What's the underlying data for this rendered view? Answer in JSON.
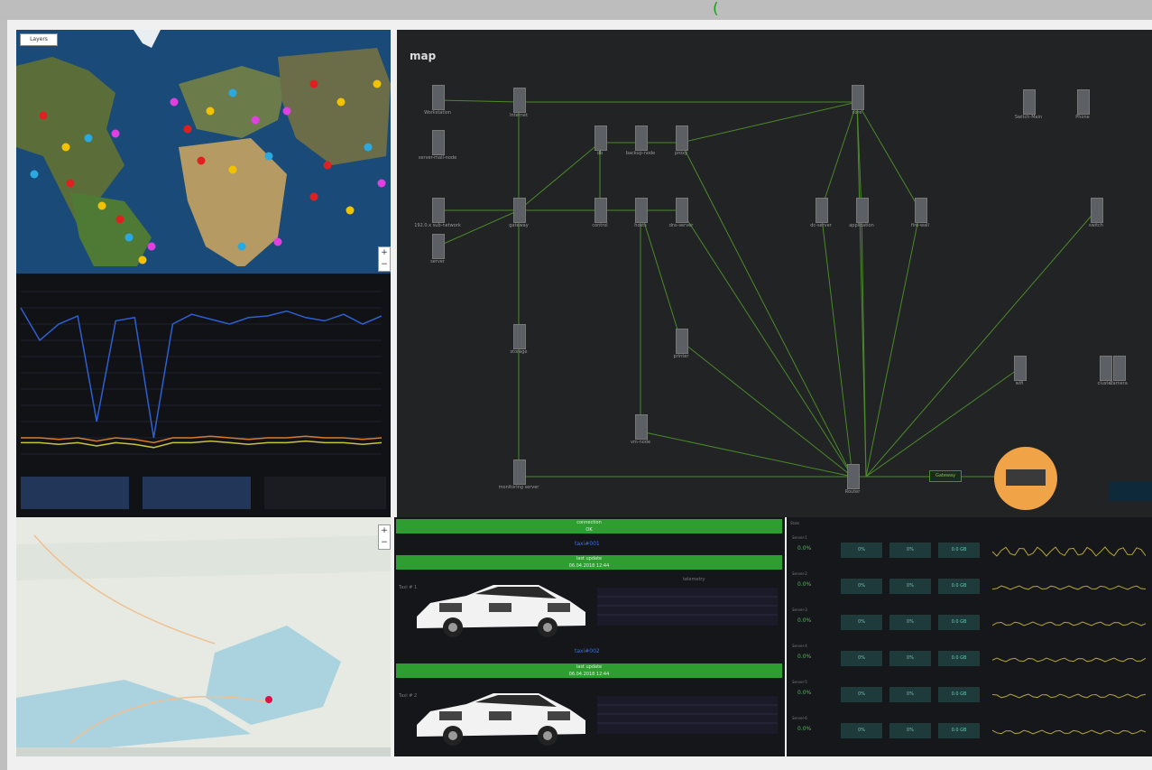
{
  "world_map": {
    "layer_button": "Layers"
  },
  "network_map": {
    "title": "map",
    "nodes": [
      {
        "id": "n1",
        "label": "Workstation"
      },
      {
        "id": "n2",
        "label": "Internet"
      },
      {
        "id": "n3",
        "label": "server-mail-node"
      },
      {
        "id": "n4",
        "label": "192.0.x sub-network"
      },
      {
        "id": "n5",
        "label": "server"
      },
      {
        "id": "n6",
        "label": "gateway"
      },
      {
        "id": "n7",
        "label": "db"
      },
      {
        "id": "n8",
        "label": "backup-node"
      },
      {
        "id": "n9",
        "label": "proxy"
      },
      {
        "id": "n10",
        "label": "control"
      },
      {
        "id": "n11",
        "label": "hosts"
      },
      {
        "id": "n12",
        "label": "dns-server"
      },
      {
        "id": "n13",
        "label": "storage"
      },
      {
        "id": "n14",
        "label": "printer"
      },
      {
        "id": "n15",
        "label": "vm-node"
      },
      {
        "id": "n16",
        "label": "monitoring server"
      },
      {
        "id": "n17",
        "label": "core"
      },
      {
        "id": "n18",
        "label": "dc-server"
      },
      {
        "id": "n19",
        "label": "application"
      },
      {
        "id": "n20",
        "label": "fire-wall"
      },
      {
        "id": "n21",
        "label": "wifi"
      },
      {
        "id": "n22",
        "label": "switch"
      },
      {
        "id": "n23",
        "label": "cluster"
      },
      {
        "id": "n24",
        "label": "Router"
      },
      {
        "id": "n25",
        "label": "Switch-Main"
      },
      {
        "id": "n26",
        "label": "Phone"
      },
      {
        "id": "n27",
        "label": "Camera"
      }
    ],
    "link_label": "Gateway"
  },
  "car_panel": {
    "bar1_line1": "connection",
    "bar1_line2": "OK",
    "blue_label_1": "taxi#001",
    "bar2_line1": "last update",
    "bar2_line2": "06.04.2018 12:44",
    "blue_label_2": "taxi#002",
    "bar3_line1": "last update",
    "bar3_line2": "06.04.2018 12:44",
    "car1_id": "Taxi # 1",
    "car2_id": "Taxi # 2",
    "chart_title": "telemetry"
  },
  "stats_panel": {
    "title": "Stats",
    "rows": [
      {
        "name": "Server-1",
        "big": "0.0%",
        "b1": "0%",
        "b2": "0%",
        "b3": "0.0 GB"
      },
      {
        "name": "Server-2",
        "big": "0.0%",
        "b1": "0%",
        "b2": "0%",
        "b3": "0.0 GB"
      },
      {
        "name": "Server-3",
        "big": "0.0%",
        "b1": "0%",
        "b2": "0%",
        "b3": "0.0 GB"
      },
      {
        "name": "Server-4",
        "big": "0.0%",
        "b1": "0%",
        "b2": "0%",
        "b3": "0.0 GB"
      },
      {
        "name": "Server-5",
        "big": "0.0%",
        "b1": "0%",
        "b2": "0%",
        "b3": "0.0 GB"
      },
      {
        "name": "Server-6",
        "big": "0.0%",
        "b1": "0%",
        "b2": "0%",
        "b3": "0.0 GB"
      }
    ]
  },
  "chart_data": {
    "type": "line",
    "title": "",
    "series": [
      {
        "values": [
          90,
          70,
          80,
          85,
          20,
          82,
          84,
          10,
          80,
          86,
          83,
          80,
          84,
          85,
          88,
          84,
          82,
          86,
          80,
          85
        ]
      },
      {
        "values": [
          10,
          10,
          9,
          10,
          8,
          10,
          9,
          7,
          10,
          10,
          11,
          10,
          9,
          10,
          10,
          11,
          10,
          10,
          9,
          10
        ]
      },
      {
        "values": [
          7,
          7,
          6,
          7,
          5,
          7,
          6,
          4,
          7,
          7,
          8,
          7,
          6,
          7,
          7,
          8,
          7,
          7,
          6,
          7
        ]
      }
    ],
    "colors": [
      "#2e5fd1",
      "#d97a2b",
      "#c9c23a"
    ],
    "ylim": [
      0,
      100
    ]
  }
}
